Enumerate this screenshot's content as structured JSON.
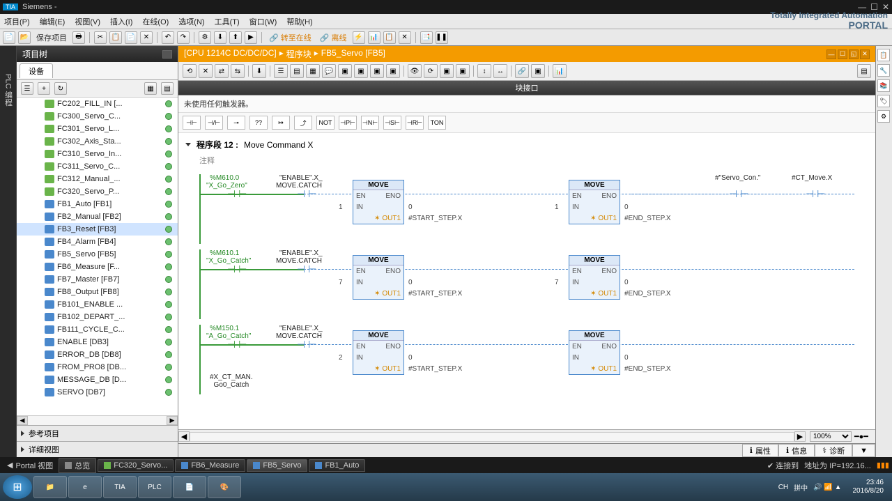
{
  "titlebar": {
    "logo": "TIA",
    "title": "Siemens  -"
  },
  "menu": [
    "项目(P)",
    "编辑(E)",
    "视图(V)",
    "插入(I)",
    "在线(O)",
    "选项(N)",
    "工具(T)",
    "窗口(W)",
    "帮助(H)"
  ],
  "brand": {
    "line1": "Totally Integrated Automation",
    "line2": "PORTAL"
  },
  "toolbar": {
    "save": "保存项目",
    "online": "转至在线",
    "offline": "离线"
  },
  "vtab": "PLC 编程",
  "tree": {
    "header": "项目树",
    "tab": "设备",
    "items": [
      {
        "icon": "fc",
        "label": "FC202_FILL_IN [..."
      },
      {
        "icon": "fc",
        "label": "FC300_Servo_C..."
      },
      {
        "icon": "fc",
        "label": "FC301_Servo_L..."
      },
      {
        "icon": "fc",
        "label": "FC302_Axis_Sta..."
      },
      {
        "icon": "fc",
        "label": "FC310_Servo_In..."
      },
      {
        "icon": "fc",
        "label": "FC311_Servo_C..."
      },
      {
        "icon": "fc",
        "label": "FC312_Manual_..."
      },
      {
        "icon": "fc",
        "label": "FC320_Servo_P..."
      },
      {
        "icon": "fb",
        "label": "FB1_Auto [FB1]"
      },
      {
        "icon": "fb",
        "label": "FB2_Manual [FB2]"
      },
      {
        "icon": "fb",
        "label": "FB3_Reset [FB3]",
        "selected": true
      },
      {
        "icon": "fb",
        "label": "FB4_Alarm [FB4]"
      },
      {
        "icon": "fb",
        "label": "FB5_Servo [FB5]"
      },
      {
        "icon": "fb",
        "label": "FB6_Measure [F..."
      },
      {
        "icon": "fb",
        "label": "FB7_Master [FB7]"
      },
      {
        "icon": "fb",
        "label": "FB8_Output [FB8]"
      },
      {
        "icon": "fb",
        "label": "FB101_ENABLE ..."
      },
      {
        "icon": "fb",
        "label": "FB102_DEPART_..."
      },
      {
        "icon": "fb",
        "label": "FB111_CYCLE_C..."
      },
      {
        "icon": "db",
        "label": "ENABLE [DB3]"
      },
      {
        "icon": "db",
        "label": "ERROR_DB [DB8]"
      },
      {
        "icon": "db",
        "label": "FROM_PRO8 [DB..."
      },
      {
        "icon": "db",
        "label": "MESSAGE_DB [D..."
      },
      {
        "icon": "db",
        "label": "SERVO [DB7]"
      }
    ],
    "footer1": "参考项目",
    "footer2": "详细视图"
  },
  "editor": {
    "breadcrumb": [
      "[CPU 1214C DC/DC/DC]",
      "▸",
      "程序块",
      "▸",
      "FB5_Servo [FB5]"
    ],
    "interface_label": "块接口",
    "trigger": "未使用任何触发器。",
    "lad_buttons": [
      "⊣⊢",
      "⊣/⊢",
      "⊸",
      "??",
      "↦",
      "⤴",
      "NOT",
      "⊣P⊢",
      "⊣N⊢",
      "⊣S⊢",
      "⊣R⊢",
      "TON"
    ],
    "network": {
      "title": "程序段 12 :",
      "name": "Move Command X",
      "comment": "注释"
    },
    "rungs": [
      {
        "addr": "%M610.0",
        "sym": "\"X_Go_Zero\"",
        "en_addr": "\"ENABLE\".X_",
        "en_sym": "MOVE.CATCH",
        "in1": "1",
        "out1": "#START_STEP.X",
        "in2": "1",
        "out2": "#END_STEP.X",
        "right1": "#\"Servo_Con.\"",
        "right2": "#CT_Move.X",
        "in1b": "0",
        "in2b": "0"
      },
      {
        "addr": "%M610.1",
        "sym": "\"X_Go_Catch\"",
        "en_addr": "\"ENABLE\".X_",
        "en_sym": "MOVE.CATCH",
        "in1": "7",
        "out1": "#START_STEP.X",
        "in2": "7",
        "out2": "#END_STEP.X",
        "in1b": "0",
        "in2b": "0"
      },
      {
        "addr": "%M150.1",
        "sym": "\"A_Go_Catch\"",
        "en_addr": "\"ENABLE\".X_",
        "en_sym": "MOVE.CATCH",
        "in1": "2",
        "out1": "#START_STEP.X",
        "in2": "",
        "out2": "#END_STEP.X",
        "branch": "#X_CT_MAN.\nGo0_Catch",
        "in1b": "0",
        "in2b": "0"
      }
    ],
    "move_label": "MOVE",
    "en": "EN",
    "eno": "ENO",
    "in": "IN",
    "out": "OUT1",
    "zoom": "100%"
  },
  "info_tabs": [
    "属性",
    "信息",
    "诊断"
  ],
  "tasktabs": {
    "portal": "Portal 视图",
    "overview": "总览",
    "tabs": [
      {
        "color": "green",
        "label": "FC320_Servo..."
      },
      {
        "color": "blue",
        "label": "FB6_Measure"
      },
      {
        "color": "blue",
        "label": "FB5_Servo",
        "active": true
      },
      {
        "color": "blue",
        "label": "FB1_Auto"
      }
    ],
    "conn": "连接到",
    "addr": "地址为 IP=192.16..."
  },
  "win": {
    "apps": [
      "📁",
      "e",
      "TIA",
      "PLC",
      "📄",
      "🎨"
    ],
    "ime": "CH",
    "ime2": "拼中",
    "time": "23:46",
    "date": "2016/8/20"
  }
}
